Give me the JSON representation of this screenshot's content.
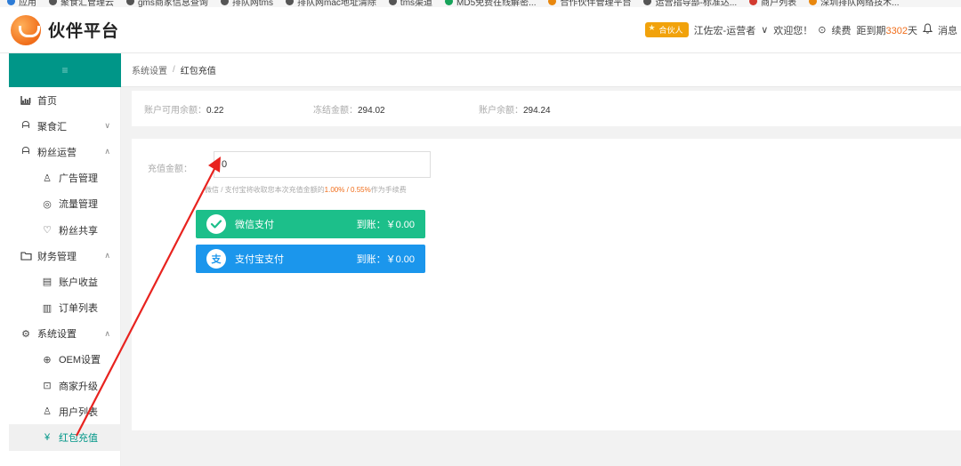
{
  "bookmarks": [
    "应用",
    "聚食汇管理云",
    "gms商家信息查询",
    "排队网tms",
    "排队网mac地址清除",
    "tms渠道",
    "MD5免费在线解密...",
    "合作伙伴管理平台",
    "运营指导部-标准达...",
    "商户列表",
    "深圳排队网络技术..."
  ],
  "header": {
    "logo_text": "伙伴平台",
    "partner_badge": "合伙人",
    "user": "江佐宏-运营者",
    "user_arrow": "∨",
    "welcome": "欢迎您！",
    "renew_icon": "⊙",
    "renew": "续费",
    "expiry_prefix": "距到期",
    "expiry_days": "3302",
    "expiry_suffix": "天",
    "message_icon": "bell-icon",
    "message": "消息"
  },
  "sidebar": {
    "toggle_icon": "≡",
    "items": [
      {
        "label": "首页",
        "icon": "chart-icon"
      },
      {
        "label": "聚食汇",
        "icon": "person-icon",
        "arrow": "∨"
      },
      {
        "label": "粉丝运营",
        "icon": "person-icon",
        "arrow": "∧"
      },
      {
        "label": "广告管理",
        "icon": "person-outline-icon",
        "sub": true
      },
      {
        "label": "流量管理",
        "icon": "flow-icon",
        "sub": true
      },
      {
        "label": "粉丝共享",
        "icon": "heart-icon",
        "sub": true
      },
      {
        "label": "财务管理",
        "icon": "folder-icon",
        "arrow": "∧"
      },
      {
        "label": "账户收益",
        "icon": "receipt-icon",
        "sub": true
      },
      {
        "label": "订单列表",
        "icon": "list-icon",
        "sub": true
      },
      {
        "label": "系统设置",
        "icon": "gear-icon",
        "arrow": "∧"
      },
      {
        "label": "OEM设置",
        "icon": "globe-icon",
        "sub": true
      },
      {
        "label": "商家升级",
        "icon": "upgrade-icon",
        "sub": true
      },
      {
        "label": "用户列表",
        "icon": "user-icon",
        "sub": true
      },
      {
        "label": "红包充值",
        "icon": "yen-icon",
        "sub": true,
        "active": true
      }
    ]
  },
  "breadcrumb": {
    "parent": "系统设置",
    "separator": "/",
    "current": "红包充值"
  },
  "balances": {
    "available_label": "账户可用余额：",
    "available_value": "0.22",
    "frozen_label": "冻结金额：",
    "frozen_value": "294.02",
    "total_label": "账户余额：",
    "total_value": "294.24"
  },
  "recharge": {
    "amount_label": "充值金额：",
    "amount_value": "0",
    "fee_note_prefix": "微信 / 支付宝将收取您本次充值金额的",
    "fee_rate": "1.00% / 0.55%",
    "fee_note_suffix": "作为手续费"
  },
  "payments": {
    "wechat": {
      "label": "微信支付",
      "arrival": "到账：￥0.00",
      "icon": "wechat-icon",
      "color": "#1cbf8a"
    },
    "alipay": {
      "label": "支付宝支付",
      "arrival": "到账：￥0.00",
      "icon": "alipay-icon",
      "color": "#1b96ec"
    }
  },
  "colors": {
    "accent": "#009688",
    "annotation": "#e8231f",
    "highlight": "#f06d1a"
  }
}
